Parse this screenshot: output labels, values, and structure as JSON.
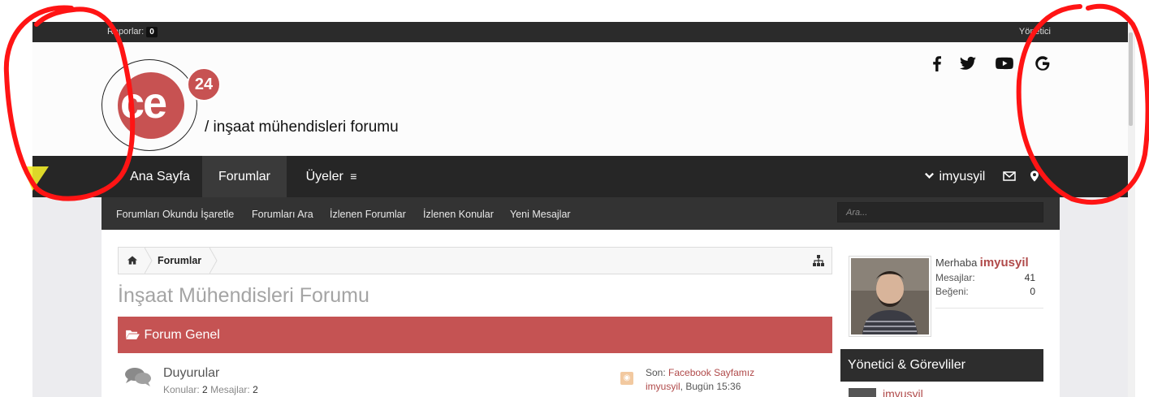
{
  "topbar": {
    "reports_label": "Raporlar:",
    "reports_count": "0",
    "admin_label": "Yönetici"
  },
  "header": {
    "logo_text": "ce",
    "logo_badge": "24",
    "tagline": "/ inşaat mühendisleri forumu",
    "social": [
      "facebook-icon",
      "twitter-icon",
      "youtube-icon",
      "google-icon"
    ]
  },
  "nav": {
    "items": [
      {
        "label": "Ana Sayfa"
      },
      {
        "label": "Forumlar"
      },
      {
        "label": "Üyeler"
      }
    ],
    "user": "imyusyil"
  },
  "subnav": {
    "items": [
      {
        "label": "Forumları Okundu İşaretle"
      },
      {
        "label": "Forumları Ara"
      },
      {
        "label": "İzlenen Forumlar"
      },
      {
        "label": "İzlenen Konular"
      },
      {
        "label": "Yeni Mesajlar"
      }
    ],
    "search_placeholder": "Ara..."
  },
  "breadcrumb": {
    "current": "Forumlar"
  },
  "page_title": "İnşaat Mühendisleri Forumu",
  "category": {
    "title": "Forum Genel"
  },
  "forums": [
    {
      "name": "Duyurular",
      "topics_label": "Konular:",
      "topics": "2",
      "messages_label": "Mesajlar:",
      "messages": "2",
      "last_prefix": "Son:",
      "last_title": "Facebook Sayfamız",
      "last_user": "imyusyil",
      "last_time": ", Bugün 15:36"
    }
  ],
  "sidebar": {
    "greeting": "Merhaba",
    "username": "imyusyil",
    "stats": [
      {
        "label": "Mesajlar:",
        "value": "41"
      },
      {
        "label": "Beğeni:",
        "value": "0"
      }
    ],
    "staff_title": "Yönetici & Görevliler",
    "staff_first": "imyusyil"
  },
  "colors": {
    "accent": "#c55353",
    "nav_bg": "#262626",
    "link": "#b04a4a",
    "annotation": "#ff0000"
  }
}
